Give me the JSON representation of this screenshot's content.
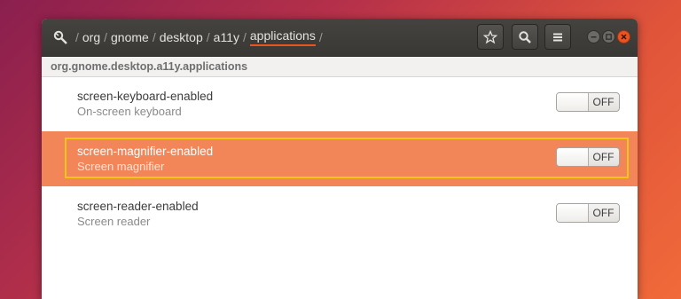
{
  "breadcrumbs": [
    "org",
    "gnome",
    "desktop",
    "a11y",
    "applications"
  ],
  "path_label": "org.gnome.desktop.a11y.applications",
  "settings": [
    {
      "key": "screen-keyboard-enabled",
      "description": "On-screen keyboard",
      "state": "OFF"
    },
    {
      "key": "screen-magnifier-enabled",
      "description": "Screen magnifier",
      "state": "OFF"
    },
    {
      "key": "screen-reader-enabled",
      "description": "Screen reader",
      "state": "OFF"
    }
  ],
  "icons": {
    "app": "dconf-editor-icon",
    "bookmark": "star-icon",
    "search": "search-icon",
    "menu": "hamburger-menu-icon"
  },
  "colors": {
    "accent": "#e95420",
    "selected_row": "#f28659",
    "focus": "#f5c518"
  }
}
